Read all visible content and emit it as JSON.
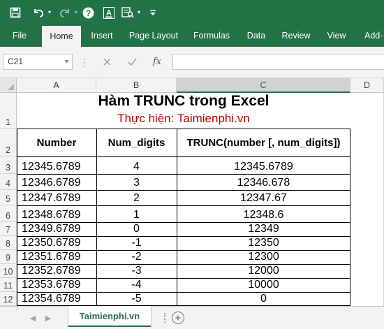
{
  "colors": {
    "brand": "#217346",
    "subtitle": "#c00000"
  },
  "quick_access": {
    "save_icon": "save-icon",
    "undo_icon": "undo-icon",
    "redo_icon": "redo-icon",
    "help_icon": "help-icon",
    "font_color_icon": "font-color-icon",
    "print_preview_icon": "print-preview-icon",
    "customize_icon": "customize-icon"
  },
  "ribbon": {
    "tabs": [
      "File",
      "Home",
      "Insert",
      "Page Layout",
      "Formulas",
      "Data",
      "Review",
      "View",
      "Add-"
    ],
    "active_tab": "Home"
  },
  "formula_bar": {
    "name_box": "C21",
    "fx_label": "fx",
    "formula": ""
  },
  "grid": {
    "columns": [
      "A",
      "B",
      "C",
      "D"
    ],
    "selected_column": "C",
    "rows": [
      "1",
      "2",
      "3",
      "4",
      "5",
      "6",
      "7",
      "8",
      "9",
      "10",
      "11",
      "12"
    ],
    "title": "Hàm TRUNC trong Excel",
    "subtitle": "Thực hiện: Taimienphi.vn",
    "headers": [
      "Number",
      "Num_digits",
      "TRUNC(number [, num_digits])"
    ],
    "data": [
      [
        "12345.6789",
        "4",
        "12345.6789"
      ],
      [
        "12346.6789",
        "3",
        "12346.678"
      ],
      [
        "12347.6789",
        "2",
        "12347.67"
      ],
      [
        "12348.6789",
        "1",
        "12348.6"
      ],
      [
        "12349.6789",
        "0",
        "12349"
      ],
      [
        "12350.6789",
        "-1",
        "12350"
      ],
      [
        "12351.6789",
        "-2",
        "12300"
      ],
      [
        "12352.6789",
        "-3",
        "12000"
      ],
      [
        "12353.6789",
        "-4",
        "10000"
      ],
      [
        "12354.6789",
        "-5",
        "0"
      ]
    ]
  },
  "sheets": {
    "active": "Taimienphi.vn",
    "add_label": "+"
  }
}
